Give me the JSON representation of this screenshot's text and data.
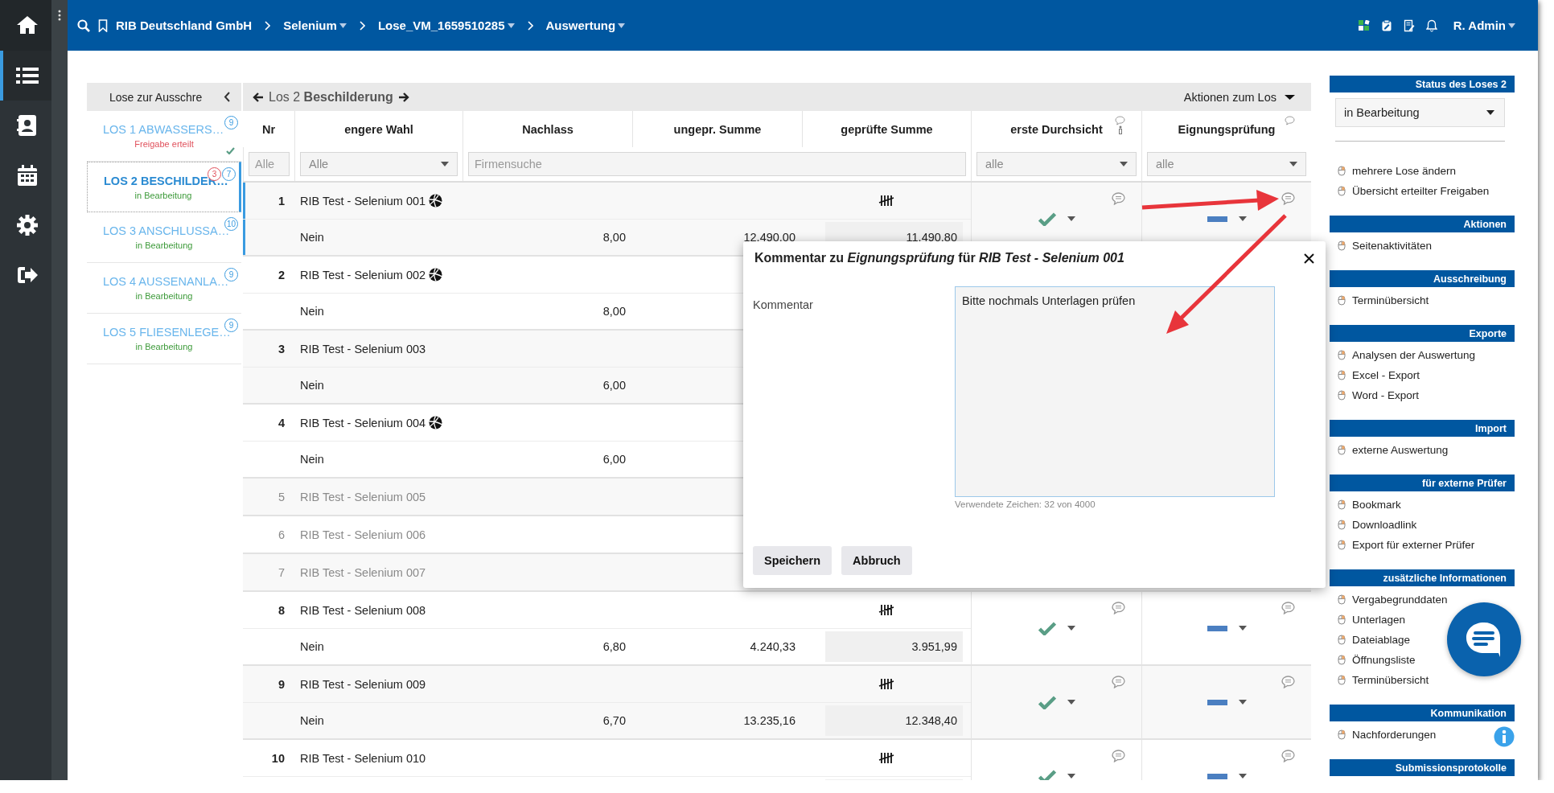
{
  "nav": {
    "items": [
      {
        "selected": false
      },
      {
        "selected": true
      },
      {
        "selected": false
      },
      {
        "selected": false
      },
      {
        "selected": false
      },
      {
        "selected": false
      }
    ]
  },
  "topbar": {
    "breadcrumbs": [
      {
        "label": "RIB Deutschland GmbH",
        "dropdown": false
      },
      {
        "label": "Selenium",
        "dropdown": true
      },
      {
        "label": "Lose_VM_1659510285",
        "dropdown": true
      },
      {
        "label": "Auswertung",
        "dropdown": true
      }
    ],
    "user": "R. Admin"
  },
  "lots": {
    "header": "Lose zur Ausschre",
    "items": [
      {
        "title": "LOS 1 ABWASSERS…",
        "status": "Freigabe erteilt",
        "color": "#e0505b",
        "count": "9",
        "approved": true,
        "selected": false
      },
      {
        "title": "LOS 2 BESCHILDER…",
        "status": "in Bearbeitung",
        "color": "#3d9a3a",
        "count": "7",
        "alert": "3",
        "approved": false,
        "selected": true
      },
      {
        "title": "LOS 3 ANSCHLUSSA…",
        "status": "in Bearbeitung",
        "color": "#3d9a3a",
        "count": "10",
        "approved": false,
        "selected": false
      },
      {
        "title": "LOS 4 AUSSENANLA…",
        "status": "in Bearbeitung",
        "color": "#3d9a3a",
        "count": "9",
        "approved": false,
        "selected": false
      },
      {
        "title": "LOS 5 FLIESENLEGE…",
        "status": "in Bearbeitung",
        "color": "#3d9a3a",
        "count": "9",
        "approved": false,
        "selected": false
      }
    ]
  },
  "table": {
    "toolbar": {
      "lot": "Los 2 **Beschilderung**",
      "actions": "Aktionen zum Los"
    },
    "columns": [
      {
        "label": "Nr"
      },
      {
        "label": "engere Wahl"
      },
      {
        "label": "Nachlass"
      },
      {
        "label": "ungepr. Summe"
      },
      {
        "label": "geprüfte Summe"
      },
      {
        "label": "erste Durchsicht",
        "info": true
      },
      {
        "label": "Eignungsprüfung",
        "info": false
      }
    ],
    "filters": [
      {
        "kind": "text",
        "placeholder": "Alle"
      },
      {
        "kind": "select",
        "value": "Alle"
      },
      {
        "kind": "search",
        "placeholder": "Firmensuche"
      },
      {
        "kind": "select",
        "value": "alle"
      },
      {
        "kind": "select",
        "value": "alle"
      }
    ],
    "rows": [
      {
        "nr": "1",
        "name": "RIB Test - Selenium 001",
        "marker": true,
        "withdrawn": false,
        "selected": true,
        "choice": "Nein",
        "discount": "8,00",
        "unchecked_sum": "12.490,00",
        "checked_sum": "11.490,80",
        "tally": true,
        "review_ok": true,
        "suitability_ok": false
      },
      {
        "nr": "2",
        "name": "RIB Test - Selenium 002",
        "marker": true,
        "withdrawn": false,
        "selected": false,
        "choice": "Nein",
        "discount": "8,00"
      },
      {
        "nr": "3",
        "name": "RIB Test - Selenium 003",
        "marker": false,
        "withdrawn": false,
        "selected": false,
        "choice": "Nein",
        "discount": "6,00"
      },
      {
        "nr": "4",
        "name": "RIB Test - Selenium 004",
        "marker": true,
        "withdrawn": false,
        "selected": false,
        "choice": "Nein",
        "discount": "6,00"
      },
      {
        "nr": "5",
        "name": "RIB Test - Selenium 005",
        "marker": false,
        "withdrawn": true,
        "selected": false
      },
      {
        "nr": "6",
        "name": "RIB Test - Selenium 006",
        "marker": false,
        "withdrawn": true,
        "selected": false
      },
      {
        "nr": "7",
        "name": "RIB Test - Selenium 007",
        "marker": false,
        "withdrawn": true,
        "selected": false
      },
      {
        "nr": "8",
        "name": "RIB Test - Selenium 008",
        "marker": false,
        "withdrawn": false,
        "selected": false,
        "choice": "Nein",
        "discount": "6,80",
        "unchecked_sum": "4.240,33",
        "checked_sum": "3.951,99",
        "tally": true,
        "review_ok": true,
        "suitability_ok": false
      },
      {
        "nr": "9",
        "name": "RIB Test - Selenium 009",
        "marker": false,
        "withdrawn": false,
        "selected": false,
        "choice": "Nein",
        "discount": "6,70",
        "unchecked_sum": "13.235,16",
        "checked_sum": "12.348,40",
        "tally": true,
        "review_ok": true,
        "suitability_ok": false
      },
      {
        "nr": "10",
        "name": "RIB Test - Selenium 010",
        "marker": false,
        "withdrawn": false,
        "selected": false,
        "tally": true,
        "review_ok": true,
        "suitability_ok": false
      }
    ]
  },
  "panel": {
    "status": {
      "title": "Status des Loses 2",
      "value": "in Bearbeitung",
      "links": [
        "mehrere Lose ändern",
        "Übersicht erteilter Freigaben"
      ]
    },
    "sections": [
      {
        "title": "Aktionen",
        "items": [
          "Seitenaktivitäten"
        ]
      },
      {
        "title": "Ausschreibung",
        "items": [
          "Terminübersicht"
        ]
      },
      {
        "title": "Exporte",
        "items": [
          "Analysen der Auswertung",
          "Excel - Export",
          "Word - Export"
        ]
      },
      {
        "title": "Import",
        "items": [
          "externe Auswertung"
        ]
      },
      {
        "title": "für externe Prüfer",
        "items": [
          "Bookmark",
          "Downloadlink",
          "Export für externer Prüfer"
        ]
      },
      {
        "title": "zusätzliche Informationen",
        "items": [
          "Vergabegrunddaten",
          "Unterlagen",
          "Dateiablage",
          "Öffnungsliste",
          "Terminübersicht"
        ]
      },
      {
        "title": "Kommunikation",
        "items": [
          "Nachforderungen"
        ]
      },
      {
        "title": "Submissionsprotokolle"
      }
    ]
  },
  "dialog": {
    "title": "Kommentar zu *Eignungsprüfung* für *RIB Test - Selenium 001*",
    "label": "Kommentar",
    "value": "Bitte nochmals Unterlagen prüfen",
    "counter": "Verwendete Zeichen: 32 von 4000",
    "buttons": [
      "Speichern",
      "Abbruch"
    ]
  }
}
